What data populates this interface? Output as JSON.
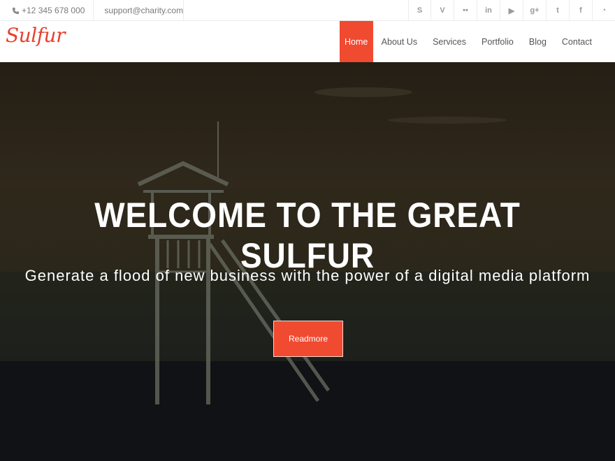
{
  "topbar": {
    "phone": "+12 345 678 000",
    "email": "support@charity.com",
    "socials": [
      {
        "icon": "skype-icon",
        "glyph": "S"
      },
      {
        "icon": "vimeo-icon",
        "glyph": "V"
      },
      {
        "icon": "flickr-icon",
        "glyph": "••"
      },
      {
        "icon": "linkedin-icon",
        "glyph": "in"
      },
      {
        "icon": "youtube-icon",
        "glyph": "▶"
      },
      {
        "icon": "google-plus-icon",
        "glyph": "g+"
      },
      {
        "icon": "twitter-icon",
        "glyph": "t"
      },
      {
        "icon": "facebook-icon",
        "glyph": "f"
      },
      {
        "icon": "rss-icon",
        "glyph": "◔"
      }
    ]
  },
  "header": {
    "logo": "Sulfur",
    "nav": [
      "Home",
      "About Us",
      "Services",
      "Portfolio",
      "Blog",
      "Contact"
    ],
    "active_nav": "Home"
  },
  "hero": {
    "title": "WELCOME TO THE GREAT SULFUR",
    "subtitle": "Generate a flood of new business with the power of a digital media platform",
    "button": "Readmore"
  },
  "colors": {
    "accent": "#f04a31",
    "logo": "#e8402c"
  }
}
